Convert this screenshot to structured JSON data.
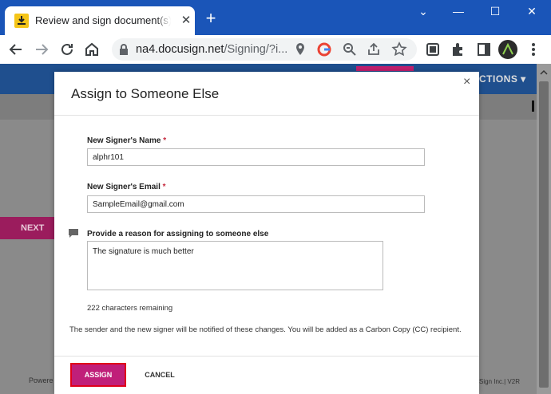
{
  "browser": {
    "tab_title": "Review and sign document(s) | DocuSign",
    "tab_close": "✕",
    "new_tab": "+",
    "url_host": "na4.docusign.net",
    "url_path": "/Signing/?i...",
    "window_min": "⌄",
    "window_minimize": "—",
    "window_max": "☐",
    "window_close": "✕"
  },
  "page": {
    "actions_label": "CTIONS ▾",
    "next_label": "NEXT",
    "footer_left": "Powere",
    "footer_right": "Sign Inc.| V2R"
  },
  "modal": {
    "title": "Assign to Someone Else",
    "close": "×",
    "name_label": "New Signer's Name",
    "name_value": "alphr101",
    "email_label": "New Signer's Email",
    "email_value": "SampleEmail@gmail.com",
    "required_mark": "*",
    "reason_label": "Provide a reason for assigning to someone else",
    "reason_value": "The signature is much better",
    "chars_remaining": "222 characters remaining",
    "notice": "The sender and the new signer will be notified of these changes. You will be added as a Carbon Copy (CC) recipient.",
    "assign_label": "ASSIGN",
    "cancel_label": "CANCEL"
  },
  "colors": {
    "chrome_blue": "#1a55b8",
    "assign_magenta": "#c01f79",
    "highlight_red": "#e0001b"
  }
}
